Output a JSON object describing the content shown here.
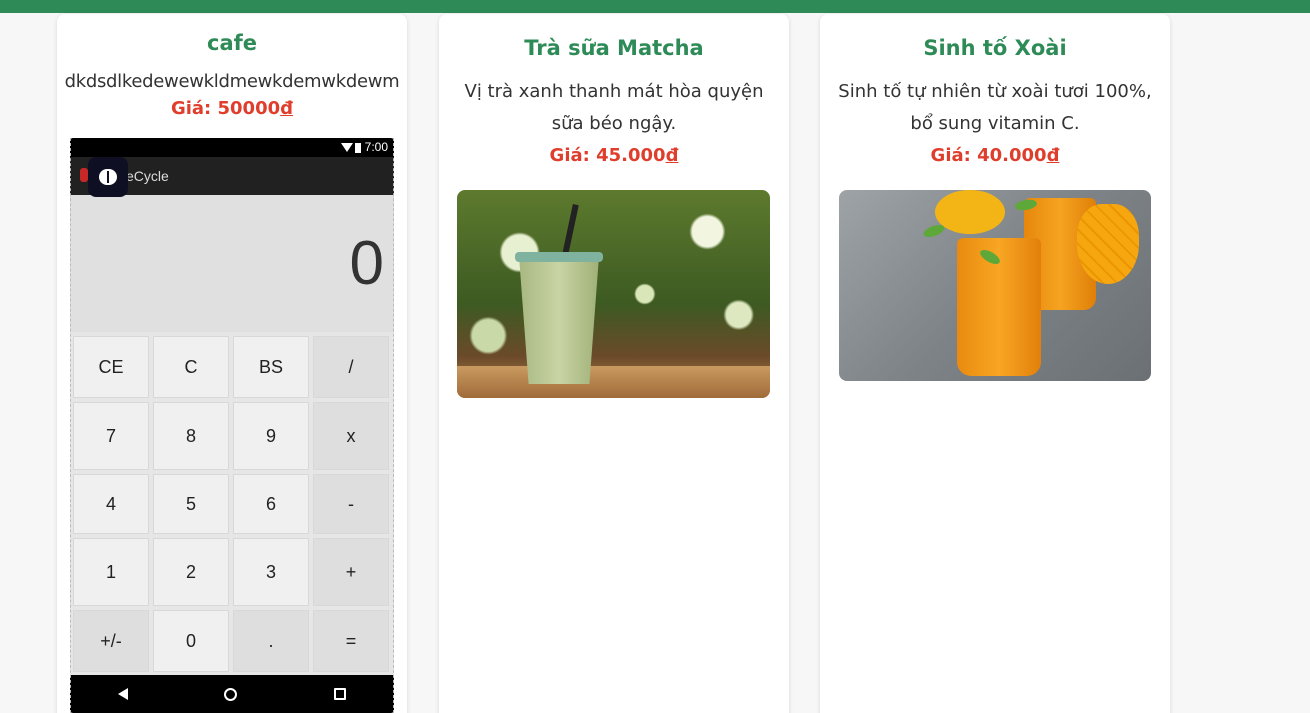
{
  "cards": [
    {
      "title": "cafe",
      "description": "dkdsdlkedewewkldmewkdemwkdewm",
      "price_prefix": "Giá: 50000",
      "currency": "đ",
      "image": {
        "status_time": "7:00",
        "app_title": "eCycle",
        "display_value": "0",
        "keys": [
          "CE",
          "C",
          "BS",
          "/",
          "7",
          "8",
          "9",
          "x",
          "4",
          "5",
          "6",
          "-",
          "1",
          "2",
          "3",
          "+",
          "+/-",
          "0",
          ".",
          "="
        ]
      }
    },
    {
      "title": "Trà sữa Matcha",
      "description_line1": "Vị trà xanh thanh mát hòa quyện",
      "description_line2": "sữa béo ngậy.",
      "price_prefix": "Giá: 45.000",
      "currency": "đ"
    },
    {
      "title": "Sinh tố Xoài",
      "description_line1": "Sinh tố tự nhiên từ xoài tươi 100%,",
      "description_line2": "bổ sung vitamin C.",
      "price_prefix": "Giá: 40.000",
      "currency": "đ"
    }
  ],
  "colors": {
    "header": "#2e8b57",
    "title": "#2e8b57",
    "price": "#e03e2d"
  }
}
